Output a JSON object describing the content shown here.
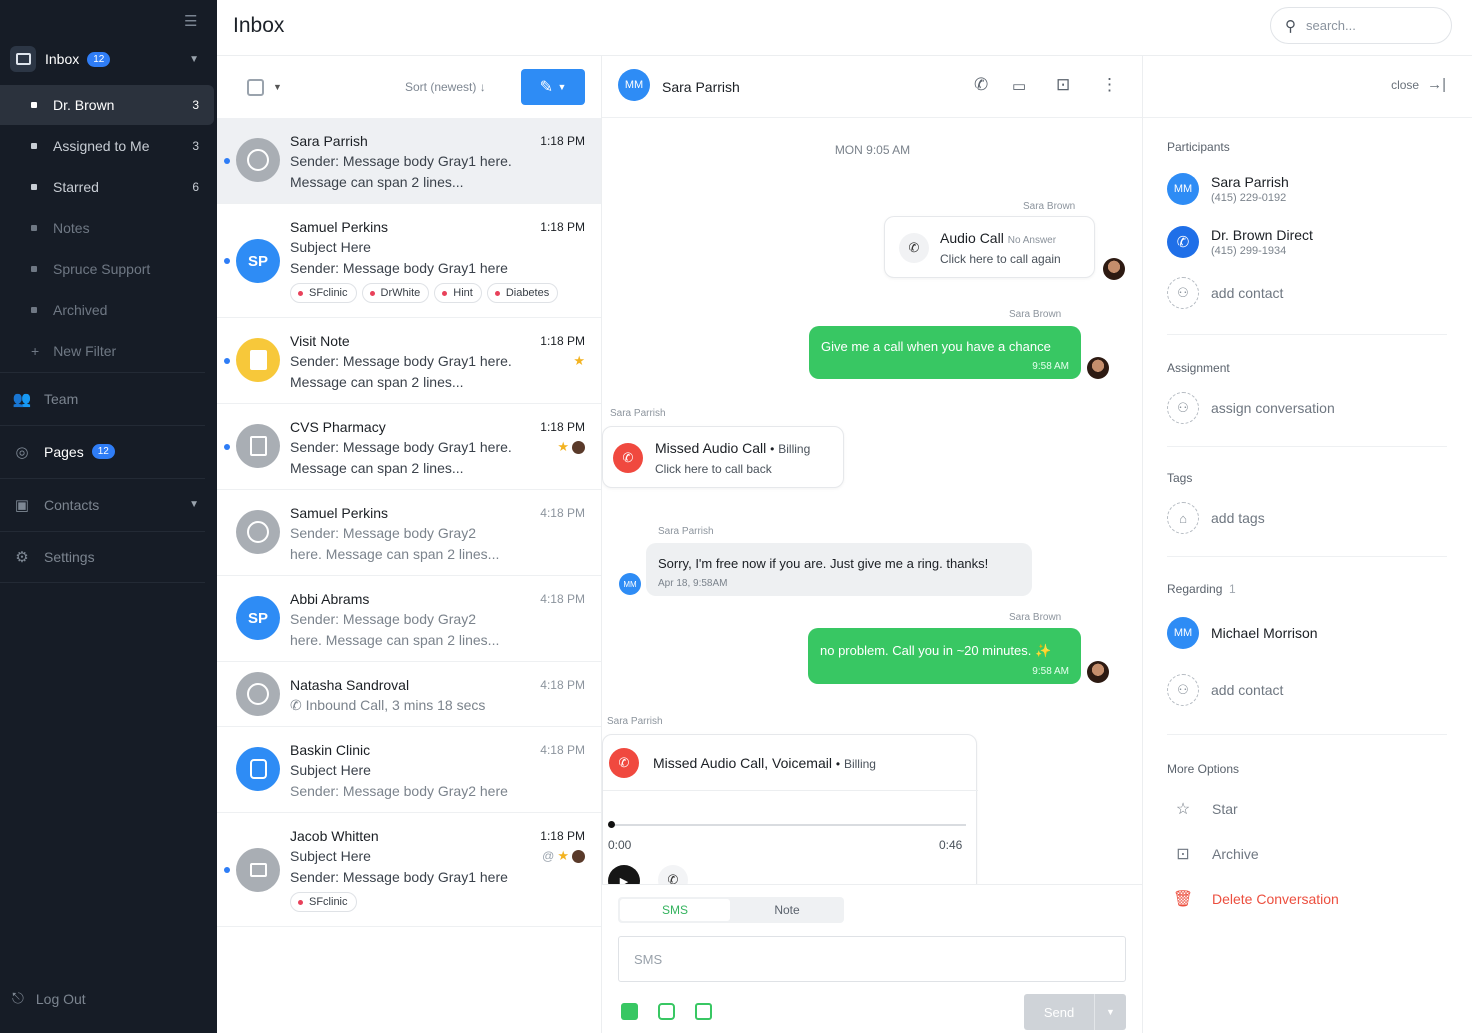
{
  "sidebar": {
    "inbox": {
      "label": "Inbox",
      "badge": "12"
    },
    "filters": [
      {
        "label": "Dr. Brown",
        "count": "3"
      },
      {
        "label": "Assigned to Me",
        "count": "3"
      },
      {
        "label": "Starred",
        "count": "6"
      },
      {
        "label": "Notes"
      },
      {
        "label": "Spruce Support"
      },
      {
        "label": "Archived"
      }
    ],
    "new_filter": "New Filter",
    "team": "Team",
    "pages": {
      "label": "Pages",
      "badge": "12"
    },
    "contacts": "Contacts",
    "settings": "Settings",
    "logout": "Log Out"
  },
  "header": {
    "title": "Inbox",
    "search_placeholder": "search..."
  },
  "list": {
    "sort_label": "Sort (newest)",
    "items": [
      {
        "name": "Sara Parrish",
        "time": "1:18 PM",
        "line1": "Sender: Message body Gray1 here.",
        "line2": "Message can span 2 lines..."
      },
      {
        "name": "Samuel Perkins",
        "initials": "SP",
        "time": "1:18 PM",
        "line1": "Subject Here",
        "line2": "Sender: Message body Gray1 here",
        "tags": [
          "SFclinic",
          "DrWhite",
          "Hint",
          "Diabetes"
        ]
      },
      {
        "name": "Visit Note",
        "time": "1:18 PM",
        "line1": "Sender: Message body Gray1 here.",
        "line2": "Message can span 2 lines..."
      },
      {
        "name": "CVS Pharmacy",
        "time": "1:18 PM",
        "line1": "Sender: Message body Gray1 here.",
        "line2": "Message can span 2 lines..."
      },
      {
        "name": "Samuel Perkins",
        "time": "4:18 PM",
        "line1": "Sender: Message body Gray2",
        "line2": "here. Message can span 2 lines..."
      },
      {
        "name": "Abbi Abrams",
        "initials": "SP",
        "time": "4:18 PM",
        "line1": "Sender: Message body Gray2",
        "line2": "here. Message can span 2 lines..."
      },
      {
        "name": "Natasha Sandroval",
        "time": "4:18 PM",
        "line1": "Inbound Call, 3 mins 18 secs"
      },
      {
        "name": "Baskin Clinic",
        "time": "4:18 PM",
        "line1": "Subject Here",
        "line2": "Sender: Message body Gray2 here"
      },
      {
        "name": "Jacob Whitten",
        "time": "1:18 PM",
        "line1": "Subject Here",
        "line2": "Sender: Message body Gray1 here",
        "tags": [
          "SFclinic"
        ]
      }
    ]
  },
  "chat": {
    "contact_initials": "MM",
    "contact_name": "Sara Parrish",
    "day_separator": "MON 9:05 AM",
    "sender_sara_brown": "Sara Brown",
    "sender_sara_parrish": "Sara Parrish",
    "audio_call": {
      "title": "Audio Call",
      "status": "No Answer",
      "sub": "Click here to call again"
    },
    "msg1": {
      "text": "Give me a call when you have a chance",
      "time": "9:58 AM"
    },
    "missed": {
      "title": "Missed Audio Call",
      "tag": "Billing",
      "sub": "Click here to call back"
    },
    "msg2": {
      "text": "Sorry, I'm free now if you are. Just give me a ring. thanks!",
      "time": "Apr 18, 9:58AM"
    },
    "msg3": {
      "text": "no problem. Call you in ~20 minutes. ✨",
      "time": "9:58 AM"
    },
    "voicemail": {
      "title": "Missed Audio Call, Voicemail",
      "tag": "Billing",
      "start": "0:00",
      "end": "0:46"
    },
    "composer": {
      "tab_sms": "SMS",
      "tab_note": "Note",
      "placeholder": "SMS",
      "send": "Send"
    }
  },
  "details": {
    "close": "close",
    "participants_label": "Participants",
    "participants": [
      {
        "initials": "MM",
        "name": "Sara Parrish",
        "phone": "(415) 229-0192"
      },
      {
        "name": "Dr. Brown Direct",
        "phone": "(415) 299-1934"
      }
    ],
    "add_contact": "add contact",
    "assignment_label": "Assignment",
    "assign": "assign conversation",
    "tags_label": "Tags",
    "add_tags": "add tags",
    "regarding_label": "Regarding",
    "regarding_count": "1",
    "regarding": {
      "initials": "MM",
      "name": "Michael Morrison"
    },
    "more_label": "More Options",
    "star": "Star",
    "archive": "Archive",
    "delete": "Delete Conversation"
  },
  "colors": {
    "sidebar_bg": "#161c26",
    "accent_blue": "#2e8cf5",
    "green_bubble": "#38c763",
    "danger": "#ec4f3f",
    "star": "#f3b321"
  }
}
